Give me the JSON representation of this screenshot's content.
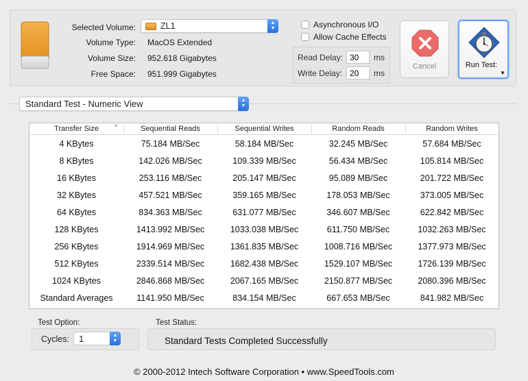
{
  "volume": {
    "selected_label": "Selected Volume:",
    "selected_value": "ZL1",
    "type_label": "Volume Type:",
    "type_value": "MacOS Extended",
    "size_label": "Volume Size:",
    "size_value": "952.618 Gigabytes",
    "free_label": "Free Space:",
    "free_value": "951.999 Gigabytes"
  },
  "options": {
    "async_io": "Asynchronous I/O",
    "cache_effects": "Allow Cache Effects",
    "read_delay_label": "Read Delay:",
    "read_delay_value": "30",
    "write_delay_label": "Write Delay:",
    "write_delay_value": "20",
    "unit": "ms"
  },
  "buttons": {
    "cancel": "Cancel",
    "run_test": "Run Test:",
    "run_test_arrow": "▼"
  },
  "view": {
    "selected": "Standard Test - Numeric View"
  },
  "table": {
    "headers": [
      "Transfer Size",
      "Sequential Reads",
      "Sequential Writes",
      "Random Reads",
      "Random Writes"
    ],
    "rows": [
      [
        "4 KBytes",
        "75.184 MB/Sec",
        "58.184 MB/Sec",
        "32.245 MB/Sec",
        "57.684 MB/Sec"
      ],
      [
        "8 KBytes",
        "142.026 MB/Sec",
        "109.339 MB/Sec",
        "56.434 MB/Sec",
        "105.814 MB/Sec"
      ],
      [
        "16 KBytes",
        "253.116 MB/Sec",
        "205.147 MB/Sec",
        "95.089 MB/Sec",
        "201.722 MB/Sec"
      ],
      [
        "32 KBytes",
        "457.521 MB/Sec",
        "359.165 MB/Sec",
        "178.053 MB/Sec",
        "373.005 MB/Sec"
      ],
      [
        "64 KBytes",
        "834.363 MB/Sec",
        "631.077 MB/Sec",
        "346.607 MB/Sec",
        "622.842 MB/Sec"
      ],
      [
        "128 KBytes",
        "1413.992 MB/Sec",
        "1033.038 MB/Sec",
        "611.750 MB/Sec",
        "1032.263 MB/Sec"
      ],
      [
        "256 KBytes",
        "1914.969 MB/Sec",
        "1361.835 MB/Sec",
        "1008.716 MB/Sec",
        "1377.973 MB/Sec"
      ],
      [
        "512 KBytes",
        "2339.514 MB/Sec",
        "1682.438 MB/Sec",
        "1529.107 MB/Sec",
        "1726.139 MB/Sec"
      ],
      [
        "1024 KBytes",
        "2846.868 MB/Sec",
        "2067.165 MB/Sec",
        "2150.877 MB/Sec",
        "2080.396 MB/Sec"
      ],
      [
        "Standard Averages",
        "1141.950 MB/Sec",
        "834.154 MB/Sec",
        "667.653 MB/Sec",
        "841.982 MB/Sec"
      ]
    ]
  },
  "test_option": {
    "label": "Test Option:",
    "cycles_label": "Cycles:",
    "cycles_value": "1"
  },
  "test_status": {
    "label": "Test Status:",
    "value": "Standard Tests Completed Successfully"
  },
  "footer": "© 2000-2012 Intech Software Corporation • www.SpeedTools.com",
  "colors": {
    "accent_blue": "#2a6fe0",
    "cancel_red": "#e8534f",
    "drive_orange": "#e79a2a"
  }
}
